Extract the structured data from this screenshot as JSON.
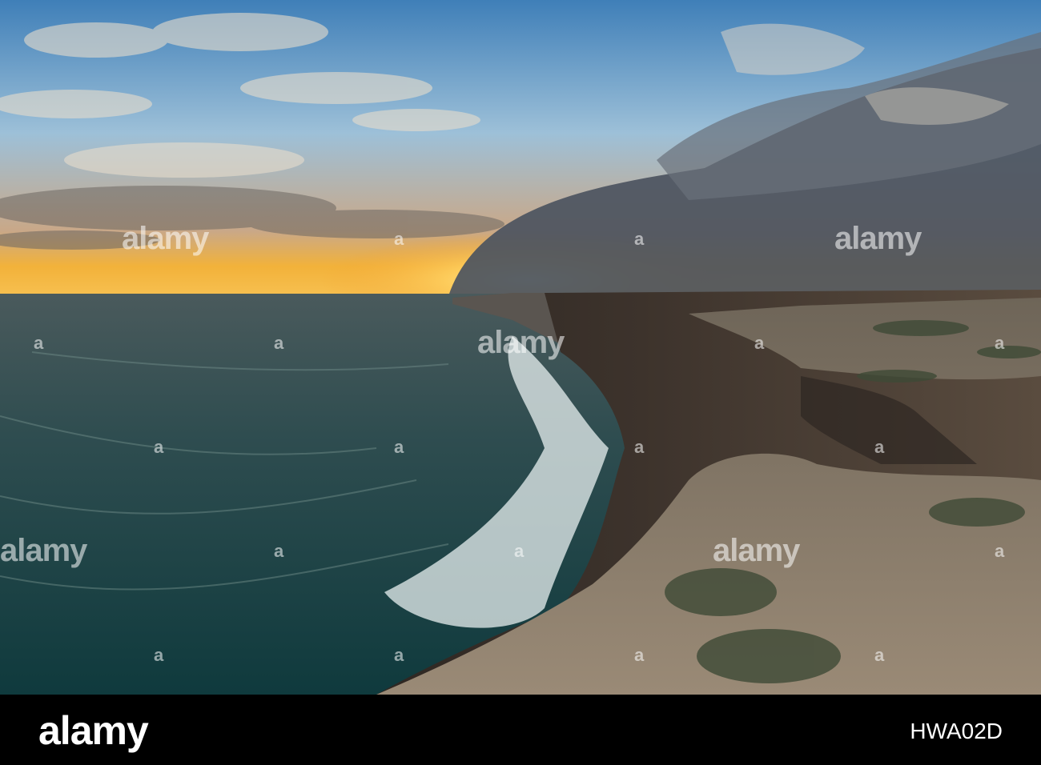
{
  "photo": {
    "subject": "sea cliffs at sunset",
    "palette": {
      "sky_top": "#3f7fb8",
      "sky_mid": "#9dc0d8",
      "horizon_glow": "#f2b23a",
      "storm_cloud": "#4c5460",
      "sea_far": "#4a5a5c",
      "sea_near": "#0f3a3d",
      "cliff_face": "#3d332c",
      "cliff_top": "#8a7c6a",
      "surf": "#e8f0f0"
    }
  },
  "watermark": {
    "text": "alamy",
    "dot": "a"
  },
  "footer": {
    "logo": "alamy",
    "image_id": "HWA02D",
    "background": "#000000",
    "text_color": "#ffffff"
  }
}
